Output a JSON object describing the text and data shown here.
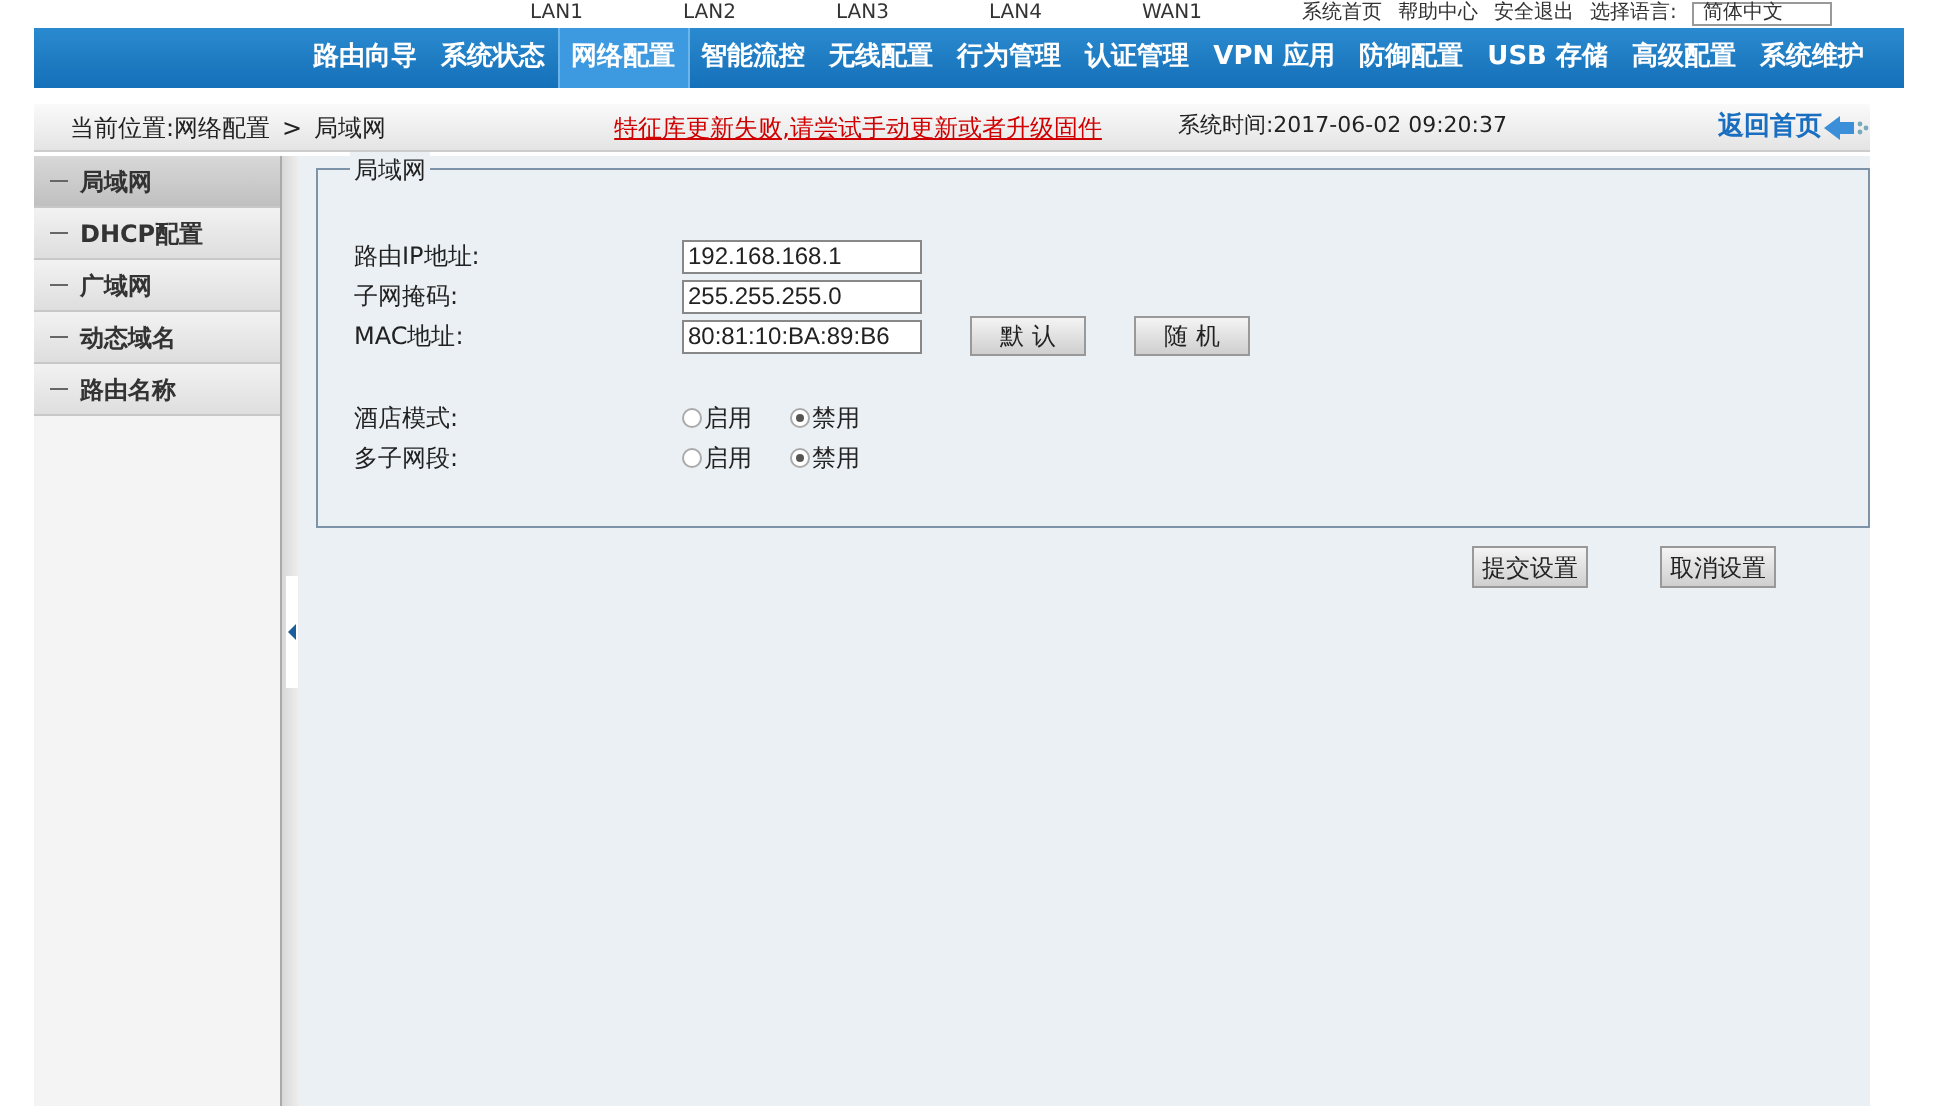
{
  "top_strip": {
    "ports": [
      "LAN1",
      "LAN2",
      "LAN3",
      "LAN4",
      "WAN1"
    ],
    "links": [
      "系统首页",
      "帮助中心",
      "安全退出"
    ],
    "language_label": "选择语言:",
    "language": "简体中文"
  },
  "nav": [
    {
      "label": "路由向导",
      "selected": false
    },
    {
      "label": "系统状态",
      "selected": false
    },
    {
      "label": "网络配置",
      "selected": true
    },
    {
      "label": "智能流控",
      "selected": false
    },
    {
      "label": "无线配置",
      "selected": false
    },
    {
      "label": "行为管理",
      "selected": false
    },
    {
      "label": "认证管理",
      "selected": false
    },
    {
      "label": "VPN 应用",
      "selected": false
    },
    {
      "label": "防御配置",
      "selected": false
    },
    {
      "label": "USB 存储",
      "selected": false
    },
    {
      "label": "高级配置",
      "selected": false
    },
    {
      "label": "系统维护",
      "selected": false
    }
  ],
  "breadcrumb": {
    "prefix": "当前位置:网络配置",
    "separator": ">",
    "current": "局域网"
  },
  "alert": "特征库更新失败,请尝试手动更新或者升级固件",
  "system_time": "系统时间:2017-06-02 09:20:37",
  "home_link": "返回首页",
  "sidebar": [
    {
      "label": "局域网",
      "selected": true
    },
    {
      "label": "DHCP配置",
      "selected": false
    },
    {
      "label": "广域网",
      "selected": false
    },
    {
      "label": "动态域名",
      "selected": false
    },
    {
      "label": "路由名称",
      "selected": false
    }
  ],
  "panel": {
    "legend": "局域网",
    "fields": [
      {
        "label": "路由IP地址:",
        "value": "192.168.168.1"
      },
      {
        "label": "子网掩码:",
        "value": "255.255.255.0"
      },
      {
        "label": "MAC地址:",
        "value": "80:81:10:BA:89:B6",
        "buttons": [
          "默 认",
          "随 机"
        ]
      }
    ],
    "radios": [
      {
        "label": "酒店模式:",
        "options": [
          {
            "label": "启用",
            "selected": false
          },
          {
            "label": "禁用",
            "selected": true
          }
        ]
      },
      {
        "label": "多子网段:",
        "options": [
          {
            "label": "启用",
            "selected": false
          },
          {
            "label": "禁用",
            "selected": true
          }
        ]
      }
    ]
  },
  "actions": [
    "提交设置",
    "取消设置"
  ]
}
